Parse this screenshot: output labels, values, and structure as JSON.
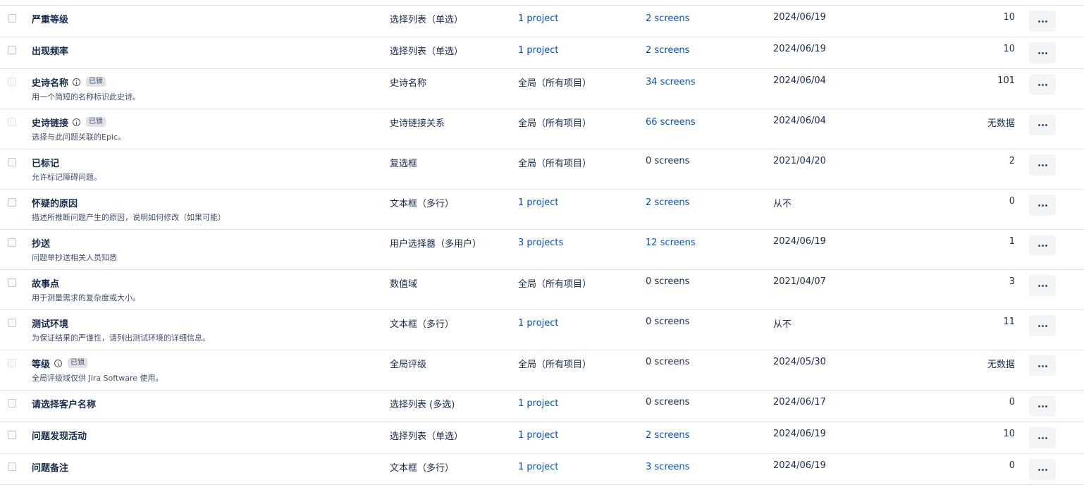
{
  "fields": [
    {
      "name": "严重等级",
      "description": "",
      "locked": false,
      "type": "选择列表（单选）",
      "context": "1 project",
      "context_link": true,
      "screens": "2 screens",
      "screens_link": true,
      "last_used": "2024/06/19",
      "issues": "10"
    },
    {
      "name": "出现频率",
      "description": "",
      "locked": false,
      "type": "选择列表（单选）",
      "context": "1 project",
      "context_link": true,
      "screens": "2 screens",
      "screens_link": true,
      "last_used": "2024/06/19",
      "issues": "10"
    },
    {
      "name": "史诗名称",
      "description": "用一个简短的名称标识此史诗。",
      "locked": true,
      "type": "史诗名称",
      "context": "全局（所有项目）",
      "context_link": false,
      "screens": "34 screens",
      "screens_link": true,
      "last_used": "2024/06/04",
      "issues": "101"
    },
    {
      "name": "史诗链接",
      "description": "选择与此问题关联的Epic。",
      "locked": true,
      "type": "史诗链接关系",
      "context": "全局（所有项目）",
      "context_link": false,
      "screens": "66 screens",
      "screens_link": true,
      "last_used": "2024/06/04",
      "issues": "无数据"
    },
    {
      "name": "已标记",
      "description": "允许标记障碍问题。",
      "locked": false,
      "type": "复选框",
      "context": "全局（所有项目）",
      "context_link": false,
      "screens": "0 screens",
      "screens_link": false,
      "last_used": "2021/04/20",
      "issues": "2"
    },
    {
      "name": "怀疑的原因",
      "description": "描述所推断问题产生的原因，说明如何修改（如果可能）",
      "locked": false,
      "type": "文本框（多行）",
      "context": "1 project",
      "context_link": true,
      "screens": "2 screens",
      "screens_link": true,
      "last_used": "从不",
      "issues": "0"
    },
    {
      "name": "抄送",
      "description": "问题单抄送相关人员知悉",
      "locked": false,
      "type": "用户选择器（多用户）",
      "context": "3 projects",
      "context_link": true,
      "screens": "12 screens",
      "screens_link": true,
      "last_used": "2024/06/19",
      "issues": "1"
    },
    {
      "name": "故事点",
      "description": "用于测量需求的复杂度或大小。",
      "locked": false,
      "type": "数值域",
      "context": "全局（所有项目）",
      "context_link": false,
      "screens": "0 screens",
      "screens_link": false,
      "last_used": "2021/04/07",
      "issues": "3"
    },
    {
      "name": "测试环境",
      "description": "为保证结果的严谨性，请列出测试环境的详细信息。",
      "locked": false,
      "type": "文本框（多行）",
      "context": "1 project",
      "context_link": true,
      "screens": "0 screens",
      "screens_link": false,
      "last_used": "从不",
      "issues": "11"
    },
    {
      "name": "等级",
      "description": "全局评级域仅供 Jira Software 使用。",
      "locked": true,
      "type": "全局评级",
      "context": "全局（所有项目）",
      "context_link": false,
      "screens": "0 screens",
      "screens_link": false,
      "last_used": "2024/05/30",
      "issues": "无数据"
    },
    {
      "name": "请选择客户名称",
      "description": "",
      "locked": false,
      "type": "选择列表 (多选)",
      "context": "1 project",
      "context_link": true,
      "screens": "0 screens",
      "screens_link": false,
      "last_used": "2024/06/17",
      "issues": "0"
    },
    {
      "name": "问题发现活动",
      "description": "",
      "locked": false,
      "type": "选择列表（单选）",
      "context": "1 project",
      "context_link": true,
      "screens": "2 screens",
      "screens_link": true,
      "last_used": "2024/06/19",
      "issues": "10"
    },
    {
      "name": "问题备注",
      "description": "",
      "locked": false,
      "type": "文本框（多行）",
      "context": "1 project",
      "context_link": true,
      "screens": "3 screens",
      "screens_link": true,
      "last_used": "2024/06/19",
      "issues": "0"
    }
  ],
  "locked_badge": "已锁",
  "icons": {
    "info": "info-icon",
    "more": "more-actions-icon",
    "checkbox": "checkbox"
  },
  "colors": {
    "link": "#0052cc",
    "text": "#172b4d",
    "border": "#dfe1e6",
    "badge_bg": "#dfe1e6",
    "more_bg": "#f4f5f7"
  }
}
